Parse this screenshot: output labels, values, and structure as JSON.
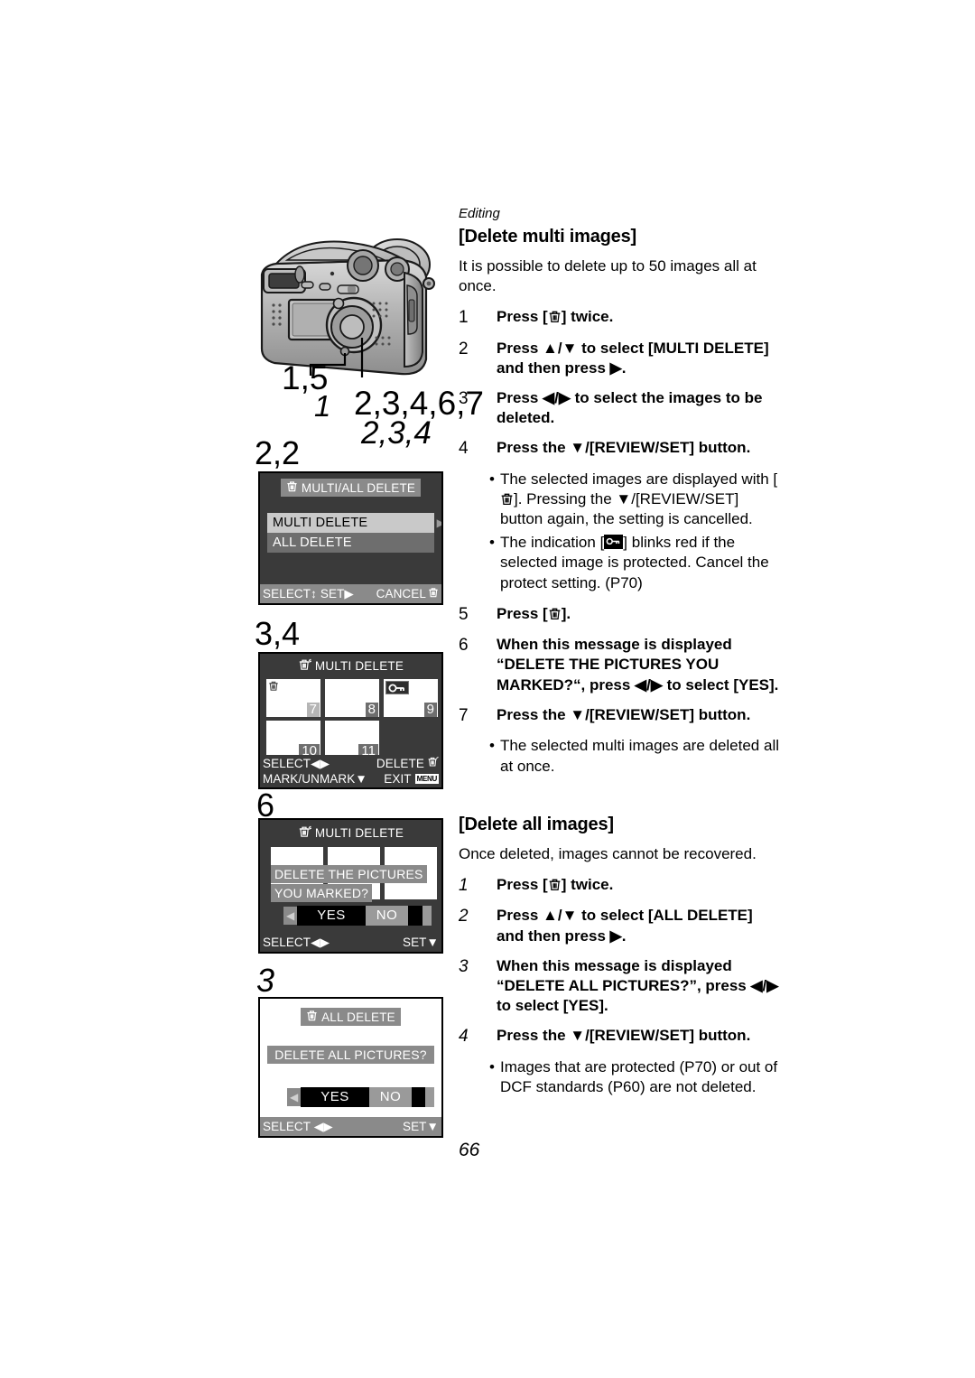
{
  "page": {
    "number": "66",
    "running_head": "Editing"
  },
  "camera_callouts": {
    "label_1": "1,5",
    "label_2": "1",
    "label_3": "2,3,4,6,7",
    "label_4": "2,3,4"
  },
  "screen_markers": {
    "screen1": "2,2",
    "screen2": "3,4",
    "screen3": "6",
    "screen4": "3"
  },
  "screens": [
    {
      "id": "multi-all-delete-menu",
      "title": "MULTI/ALL DELETE",
      "title_icon": "trash-icon",
      "menu": [
        {
          "label": "MULTI DELETE",
          "selected": true,
          "arrow": "▶"
        },
        {
          "label": "ALL DELETE",
          "selected": false,
          "arrow": ""
        }
      ],
      "bottom_left": "SELECT",
      "bottom_left_icon": "↕",
      "bottom_mid": "SET",
      "bottom_mid_icon": "▶",
      "bottom_right": "CANCEL",
      "bottom_right_icon": "trash-icon"
    },
    {
      "id": "multi-delete-grid",
      "title": "MULTI DELETE",
      "title_icon": "trash-icon",
      "thumbnails": [
        {
          "number": "7",
          "marked": true,
          "protected": false,
          "highlight": true
        },
        {
          "number": "8",
          "marked": false,
          "protected": false,
          "highlight": false
        },
        {
          "number": "9",
          "marked": false,
          "protected": true,
          "highlight": false
        },
        {
          "number": "10",
          "marked": false,
          "protected": false,
          "highlight": false
        },
        {
          "number": "11",
          "marked": false,
          "protected": false,
          "highlight": false
        }
      ],
      "bottom_row1_left": "SELECT",
      "bottom_row1_left_icon": "◀▶",
      "bottom_row1_right": "DELETE",
      "bottom_row1_right_icon": "trash-icon",
      "bottom_row2_left": "MARK/UNMARK",
      "bottom_row2_left_icon": "▼",
      "bottom_row2_right": "EXIT",
      "bottom_row2_right_icon": "MENU"
    },
    {
      "id": "multi-delete-confirm",
      "title": "MULTI DELETE",
      "title_icon": "trash-icon",
      "message_line1": "DELETE THE PICTURES",
      "message_line2": "YOU MARKED?",
      "yes_label": "YES",
      "no_label": "NO",
      "selected_option": "YES",
      "bottom_left": "SELECT",
      "bottom_left_icon": "◀▶",
      "bottom_right": "SET",
      "bottom_right_icon": "▼"
    },
    {
      "id": "all-delete-confirm",
      "title": "ALL DELETE",
      "title_icon": "trash-icon",
      "message_line1": "DELETE ALL PICTURES?",
      "yes_label": "YES",
      "no_label": "NO",
      "selected_option": "YES",
      "bottom_left": "SELECT",
      "bottom_left_icon": "◀▶",
      "bottom_right": "SET",
      "bottom_right_icon": "▼"
    }
  ],
  "section_multi": {
    "heading": "[Delete multi images]",
    "intro": "It is possible to delete up to 50 images all at once.",
    "steps": [
      {
        "n": "1",
        "text_before": "Press [",
        "icon": "trash-icon",
        "text_after": "] twice."
      },
      {
        "n": "2",
        "text": "Press ▲/▼ to select [MULTI DELETE] and then press ▶."
      },
      {
        "n": "3",
        "text": "Press ◀/▶ to select the images to be deleted."
      },
      {
        "n": "4",
        "text": "Press the ▼/[REVIEW/SET] button."
      }
    ],
    "bullets": [
      {
        "part1": "The selected images are displayed with [",
        "icon": "trash-icon",
        "part2": "]. Pressing the ▼/[REVIEW/SET] button again, the setting is cancelled."
      },
      {
        "part1": "The indication [",
        "icon": "protect-key-icon",
        "part2": "] blinks red if the selected image is protected. Cancel the protect setting. (P70)"
      }
    ],
    "steps2": [
      {
        "n": "5",
        "text_before": "Press [",
        "icon": "trash-icon",
        "text_after": "]."
      },
      {
        "n": "6",
        "text": "When this message is displayed “DELETE THE PICTURES YOU MARKED?“, press ◀/▶ to select [YES]."
      },
      {
        "n": "7",
        "text": "Press the ▼/[REVIEW/SET] button."
      }
    ],
    "bullets2": [
      {
        "text": "The selected multi images are deleted all at once."
      }
    ]
  },
  "section_all": {
    "heading": "[Delete all images]",
    "intro": "Once deleted, images cannot be recovered.",
    "steps": [
      {
        "n": "1",
        "text_before": "Press [",
        "icon": "trash-icon",
        "text_after": "] twice."
      },
      {
        "n": "2",
        "text": "Press ▲/▼ to select [ALL DELETE] and then press ▶."
      },
      {
        "n": "3",
        "text": "When this message is displayed “DELETE ALL PICTURES?”, press ◀/▶ to select [YES]."
      },
      {
        "n": "4",
        "text": "Press the ▼/[REVIEW/SET] button."
      }
    ],
    "bullets": [
      {
        "text": "Images that are protected (P70) or out of DCF standards (P60) are not deleted."
      }
    ]
  },
  "colors": {
    "lcd_dark": "#3a3a3a",
    "lcd_bar": "#8a8a8a",
    "menu_selected": "#c9c9c9",
    "menu_unselected": "#6e6e6e",
    "selected_option_bg": "#000000"
  }
}
